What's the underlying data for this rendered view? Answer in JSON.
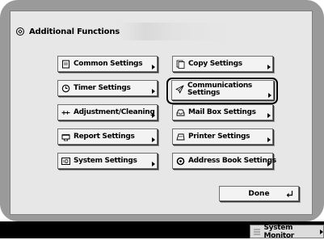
{
  "header": {
    "title": "Additional Functions",
    "icon": "additional-functions-icon"
  },
  "left_column": [
    {
      "label": "Common Settings",
      "icon": "document-icon"
    },
    {
      "label": "Timer Settings",
      "icon": "clock-icon"
    },
    {
      "label": "Adjustment/Cleaning",
      "icon": "adjustment-icon"
    },
    {
      "label": "Report Settings",
      "icon": "printer-tray-icon"
    },
    {
      "label": "System Settings",
      "icon": "id-badge-icon"
    }
  ],
  "right_column": [
    {
      "label": "Copy Settings",
      "icon": "copy-icon"
    },
    {
      "label_line1": "Communications",
      "label_line2": "Settings",
      "icon": "paper-plane-icon",
      "highlighted": true
    },
    {
      "label": "Mail Box Settings",
      "icon": "mail-box-icon"
    },
    {
      "label": "Printer Settings",
      "icon": "printer-icon"
    },
    {
      "label": "Address Book Settings",
      "icon": "address-book-icon"
    }
  ],
  "footer": {
    "done_label": "Done"
  },
  "statusbar": {
    "system_monitor_label": "System Monitor"
  },
  "colors": {
    "bezel": "#9a9a9a",
    "screen": "#e7e7e7",
    "button": "#f3f3f3",
    "statusbar": "#000000"
  }
}
